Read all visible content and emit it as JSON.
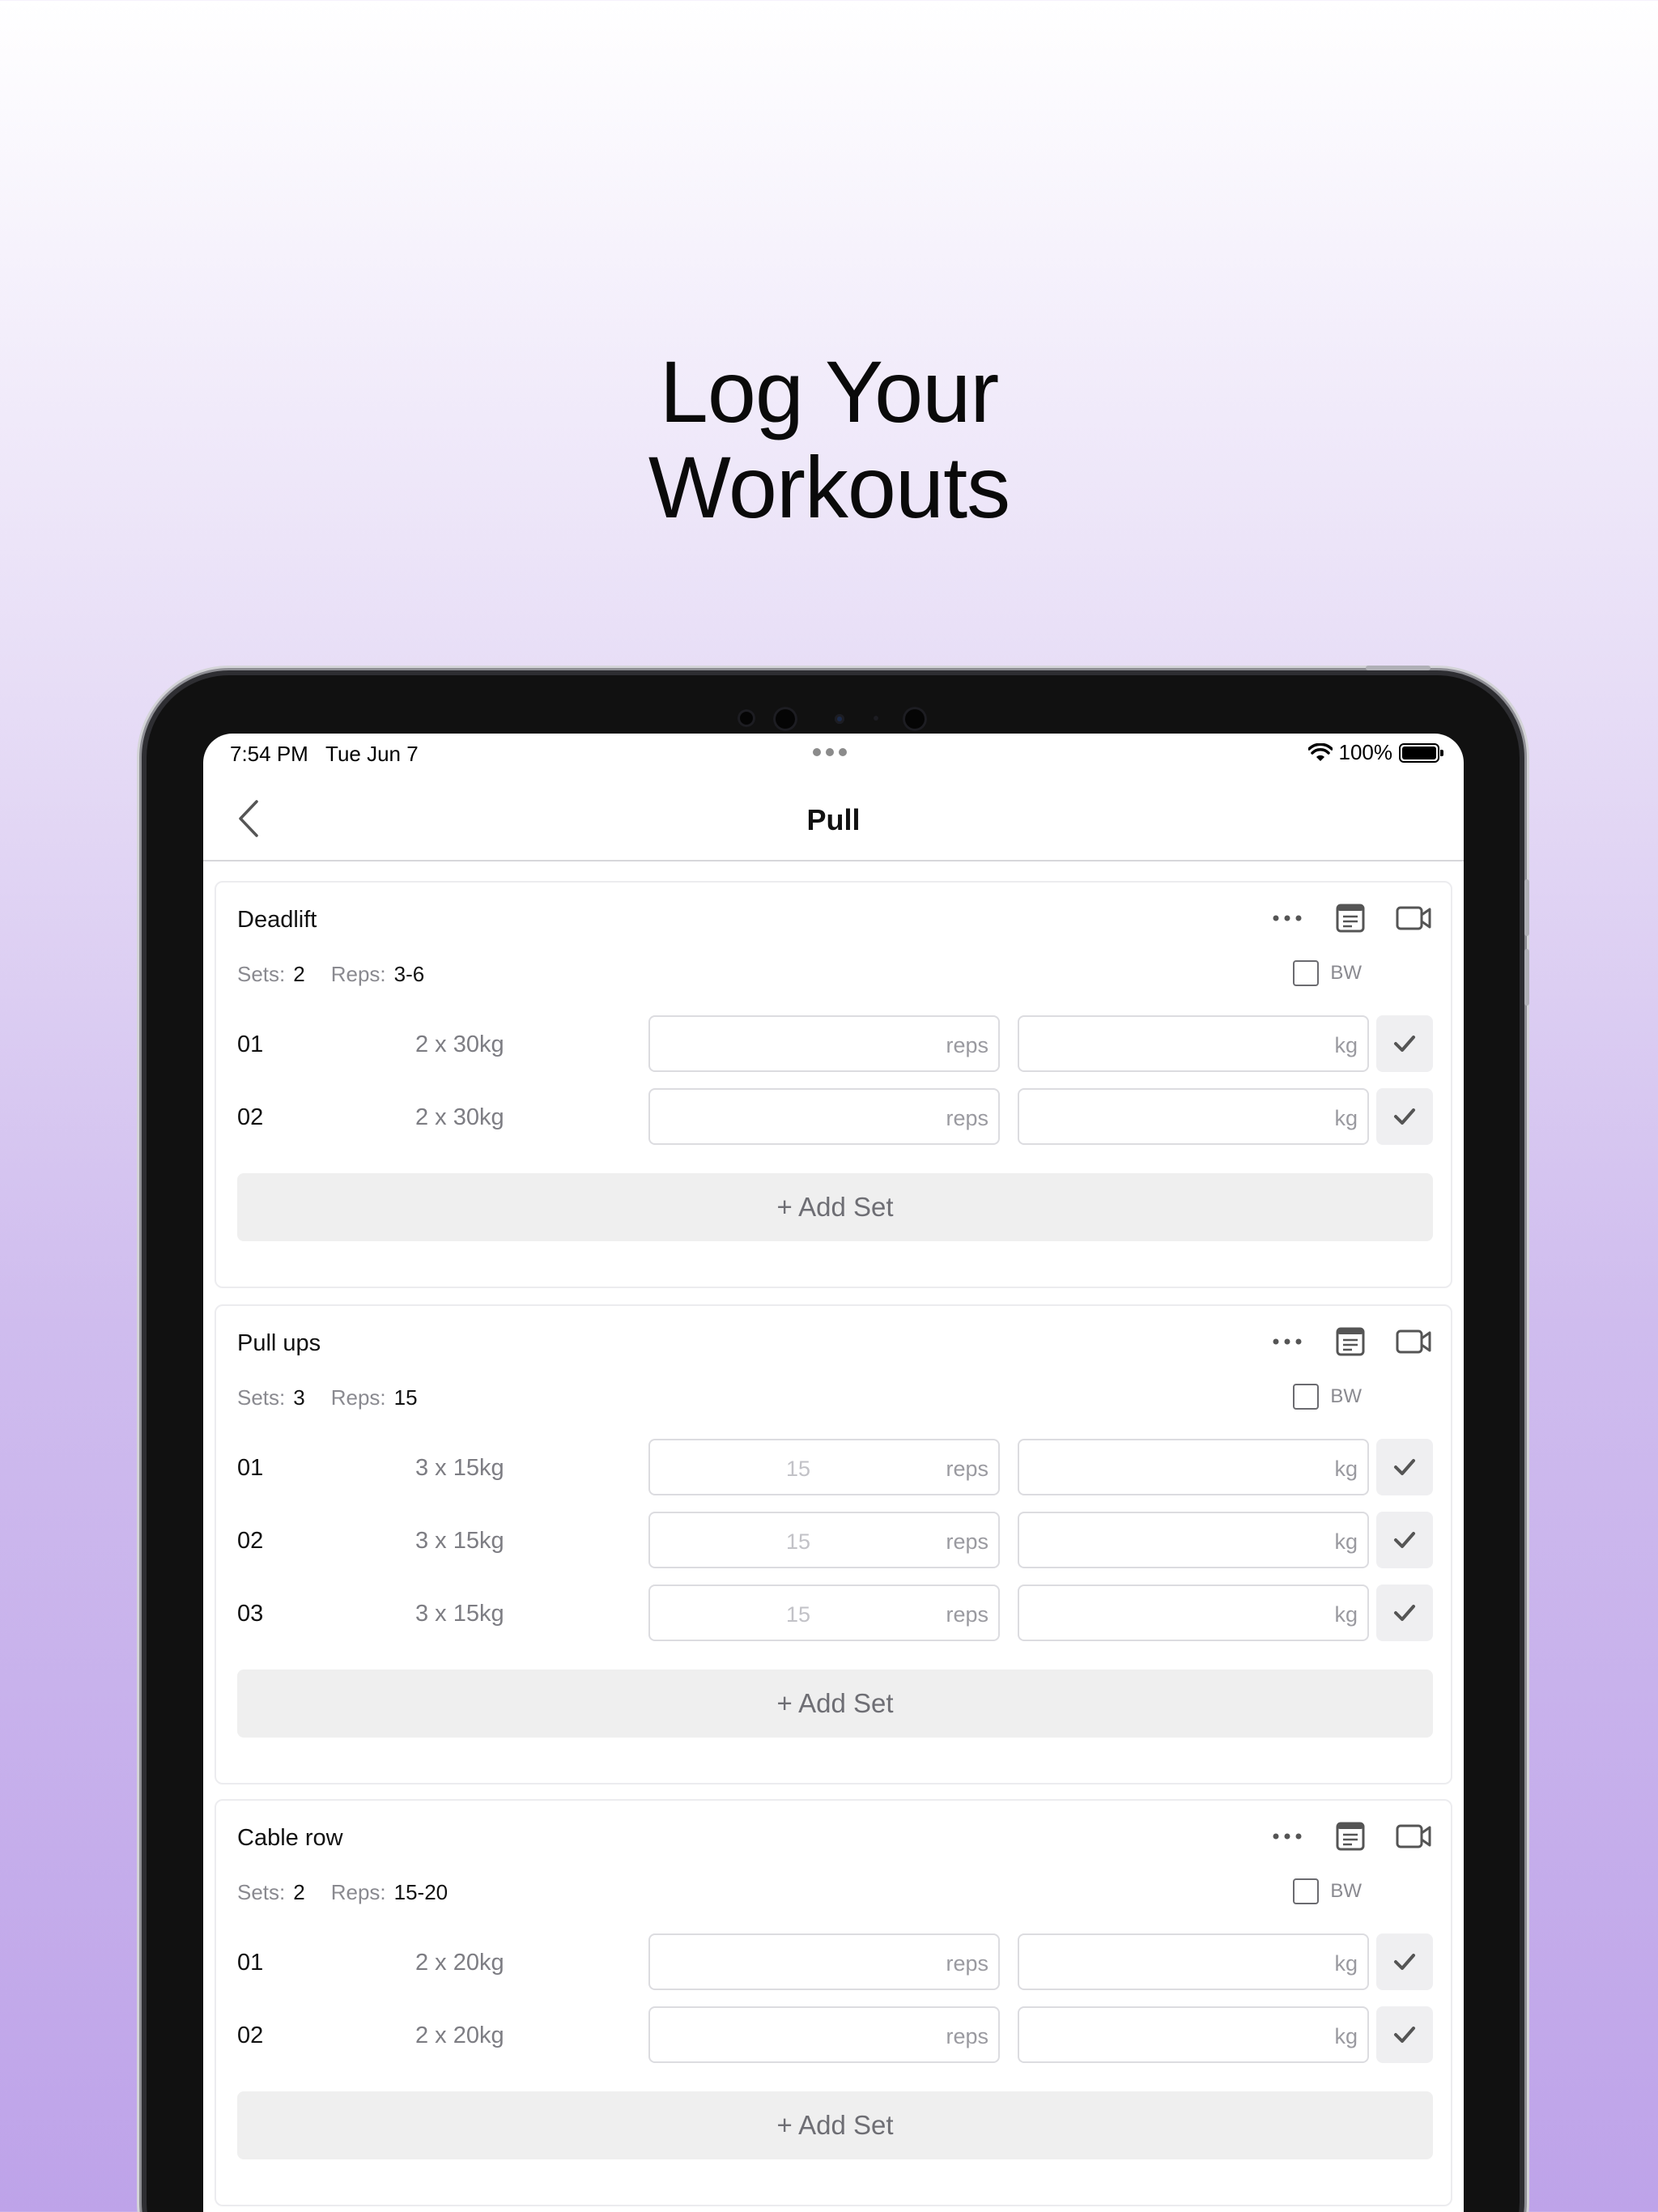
{
  "headline": {
    "line1": "Log Your",
    "line2": "Workouts"
  },
  "statusbar": {
    "time": "7:54 PM   Tue Jun 7",
    "battery": "100%"
  },
  "navbar": {
    "title": "Pull"
  },
  "labels": {
    "sets": "Sets:",
    "reps": "Reps:",
    "bw": "BW",
    "reps_placeholder": "reps",
    "kg_placeholder": "kg",
    "add_set": "+ Add Set"
  },
  "exercises": [
    {
      "name": "Deadlift",
      "sets": "2",
      "reps": "3-6",
      "rows": [
        {
          "num": "01",
          "target": "2 x 30kg",
          "reps_value": ""
        },
        {
          "num": "02",
          "target": "2 x 30kg",
          "reps_value": ""
        }
      ]
    },
    {
      "name": "Pull ups",
      "sets": "3",
      "reps": "15",
      "rows": [
        {
          "num": "01",
          "target": "3 x 15kg",
          "reps_value": "15"
        },
        {
          "num": "02",
          "target": "3 x 15kg",
          "reps_value": "15"
        },
        {
          "num": "03",
          "target": "3 x 15kg",
          "reps_value": "15"
        }
      ]
    },
    {
      "name": "Cable row",
      "sets": "2",
      "reps": "15-20",
      "rows": [
        {
          "num": "01",
          "target": "2 x 20kg",
          "reps_value": ""
        },
        {
          "num": "02",
          "target": "2 x 20kg",
          "reps_value": ""
        }
      ]
    }
  ]
}
